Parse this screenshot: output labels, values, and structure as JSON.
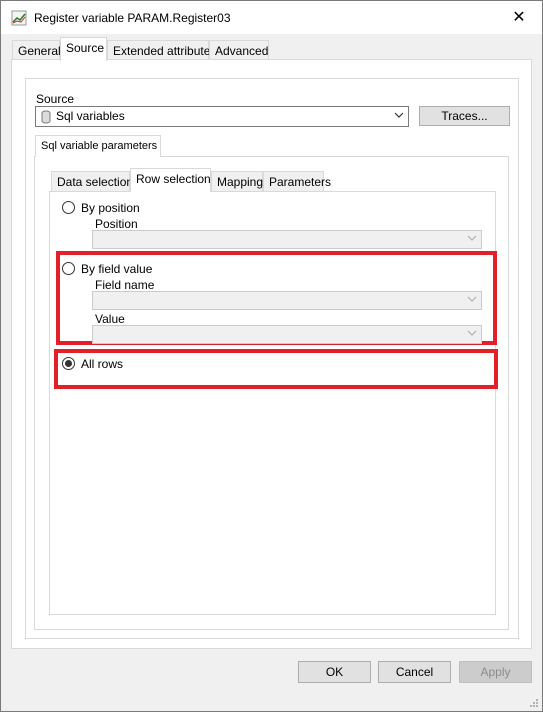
{
  "window": {
    "title": "Register variable PARAM.Register03",
    "close": "✕"
  },
  "tabs": [
    {
      "label": "General"
    },
    {
      "label": "Source"
    },
    {
      "label": "Extended attributes"
    },
    {
      "label": "Advanced"
    }
  ],
  "source": {
    "label": "Source",
    "value": "Sql variables",
    "traces_button": "Traces..."
  },
  "sql_tab": {
    "label": "Sql variable parameters"
  },
  "subtabs": [
    {
      "label": "Data selection"
    },
    {
      "label": "Row selection"
    },
    {
      "label": "Mapping"
    },
    {
      "label": "Parameters"
    }
  ],
  "row_selection": {
    "by_position": {
      "label": "By position",
      "field_label": "Position",
      "checked": false
    },
    "by_field_value": {
      "label": "By field value",
      "field_name_label": "Field name",
      "value_label": "Value",
      "checked": false
    },
    "all_rows": {
      "label": "All rows",
      "checked": true
    }
  },
  "buttons": {
    "ok": "OK",
    "cancel": "Cancel",
    "apply": "Apply"
  },
  "colors": {
    "highlight": "#e3202a",
    "window_bg": "#f0f0f0"
  }
}
